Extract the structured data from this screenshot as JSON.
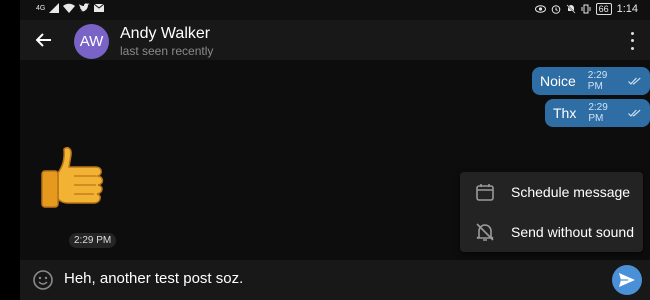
{
  "status_bar": {
    "network": "4G",
    "battery": "66",
    "time": "1:14"
  },
  "header": {
    "avatar_initials": "AW",
    "avatar_color": "#7963c7",
    "contact_name": "Andy Walker",
    "contact_status": "last seen recently"
  },
  "messages": [
    {
      "text": "Noice",
      "time": "2:29 PM",
      "status": "read"
    },
    {
      "text": "Thx",
      "time": "2:29 PM",
      "status": "read"
    }
  ],
  "sticker": {
    "icon": "thumbs-up-sticker",
    "time": "2:29 PM"
  },
  "popup_menu": {
    "items": [
      {
        "label": "Schedule message",
        "icon": "calendar-icon"
      },
      {
        "label": "Send without sound",
        "icon": "bell-off-icon"
      }
    ]
  },
  "composer": {
    "text": "Heh, another test post soz."
  },
  "colors": {
    "bubble_out": "#2f6ea5",
    "send_button": "#4a90d6",
    "background": "#0d0d0d"
  }
}
